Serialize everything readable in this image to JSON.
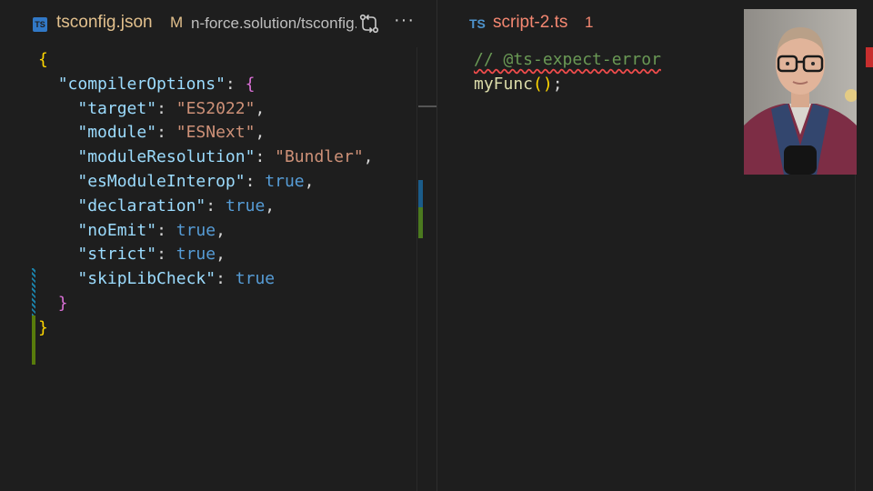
{
  "left_editor": {
    "tab": {
      "icon": "TS",
      "filename": "tsconfig.json",
      "modified_marker": "M",
      "breadcrumb": "n-force.solution/tsconfig.json"
    },
    "code_lines": [
      [
        {
          "t": "{",
          "c": "br1"
        }
      ],
      [
        {
          "t": "  "
        },
        {
          "t": "\"compilerOptions\"",
          "c": "k"
        },
        {
          "t": ": ",
          "c": "p"
        },
        {
          "t": "{",
          "c": "br2"
        }
      ],
      [
        {
          "t": "    "
        },
        {
          "t": "\"target\"",
          "c": "k"
        },
        {
          "t": ": ",
          "c": "p"
        },
        {
          "t": "\"ES2022\"",
          "c": "s"
        },
        {
          "t": ",",
          "c": "p"
        }
      ],
      [
        {
          "t": "    "
        },
        {
          "t": "\"module\"",
          "c": "k"
        },
        {
          "t": ": ",
          "c": "p"
        },
        {
          "t": "\"ESNext\"",
          "c": "s"
        },
        {
          "t": ",",
          "c": "p"
        }
      ],
      [
        {
          "t": "    "
        },
        {
          "t": "\"moduleResolution\"",
          "c": "k"
        },
        {
          "t": ": ",
          "c": "p"
        },
        {
          "t": "\"Bundler\"",
          "c": "s"
        },
        {
          "t": ",",
          "c": "p"
        }
      ],
      [
        {
          "t": "    "
        },
        {
          "t": "\"esModuleInterop\"",
          "c": "k"
        },
        {
          "t": ": ",
          "c": "p"
        },
        {
          "t": "true",
          "c": "b"
        },
        {
          "t": ",",
          "c": "p"
        }
      ],
      [
        {
          "t": "    "
        },
        {
          "t": "\"declaration\"",
          "c": "k"
        },
        {
          "t": ": ",
          "c": "p"
        },
        {
          "t": "true",
          "c": "b"
        },
        {
          "t": ",",
          "c": "p"
        }
      ],
      [
        {
          "t": "    "
        },
        {
          "t": "\"noEmit\"",
          "c": "k"
        },
        {
          "t": ": ",
          "c": "p"
        },
        {
          "t": "true",
          "c": "b"
        },
        {
          "t": ",",
          "c": "p"
        }
      ],
      [
        {
          "t": "    "
        },
        {
          "t": "\"strict\"",
          "c": "k"
        },
        {
          "t": ": ",
          "c": "p"
        },
        {
          "t": "true",
          "c": "b"
        },
        {
          "t": ",",
          "c": "p"
        }
      ],
      [
        {
          "t": "    "
        },
        {
          "t": "\"skipLibCheck\"",
          "c": "k"
        },
        {
          "t": ": ",
          "c": "p"
        },
        {
          "t": "true",
          "c": "b"
        }
      ],
      [
        {
          "t": "  "
        },
        {
          "t": "}",
          "c": "br2"
        }
      ],
      [
        {
          "t": "}",
          "c": "br1"
        }
      ]
    ]
  },
  "right_editor": {
    "tab": {
      "icon": "TS",
      "filename": "script-2.ts",
      "problem_count": "1"
    },
    "code_lines": [
      [
        {
          "t": "// @ts-expect-error",
          "c": "cm"
        }
      ],
      [
        {
          "t": "myFunc",
          "c": "fn"
        },
        {
          "t": "()",
          "c": "br1"
        },
        {
          "t": ";",
          "c": "p"
        }
      ]
    ]
  },
  "icons": {
    "compare": "compare-changes-icon",
    "more": "more-actions-icon"
  },
  "colors": {
    "background": "#1e1e1e",
    "modified": "#e2c08d",
    "error": "#f48771",
    "ts_blue": "#3178c6"
  }
}
